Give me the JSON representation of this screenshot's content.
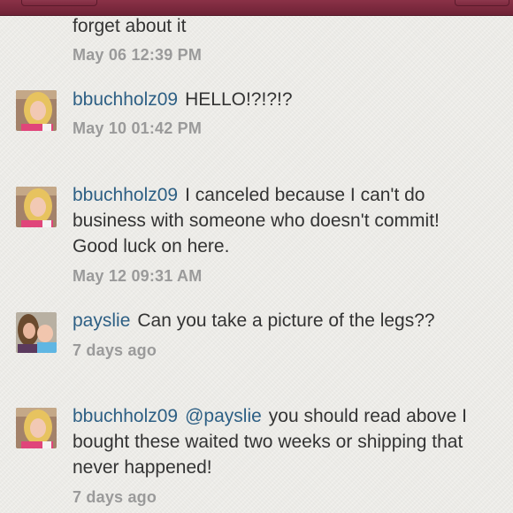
{
  "comments": [
    {
      "user": "",
      "mention": "",
      "text": "forget about it",
      "time": "May 06 12:39 PM"
    },
    {
      "user": "bbuchholz09",
      "mention": "",
      "text": "HELLO!?!?!?",
      "time": "May 10 01:42 PM",
      "avatar": "blonde-woman-avatar"
    },
    {
      "user": "bbuchholz09",
      "mention": "",
      "text": "I canceled because I can't do business with someone who doesn't commit! Good luck on here.",
      "time": "May 12 09:31 AM",
      "avatar": "blonde-woman-avatar"
    },
    {
      "user": "payslie",
      "mention": "",
      "text": "Can you take a picture of the legs??",
      "time": "7 days ago",
      "avatar": "mother-child-avatar"
    },
    {
      "user": "bbuchholz09",
      "mention": "@payslie",
      "text": "you should read above I bought these waited two weeks or shipping that never happened!",
      "time": "7 days ago",
      "avatar": "blonde-woman-avatar"
    }
  ],
  "colors": {
    "header": "#7a2a3e",
    "username": "#2d5f84",
    "text": "#333333",
    "timestamp": "#9a9a9a",
    "background": "#ecebe7"
  }
}
